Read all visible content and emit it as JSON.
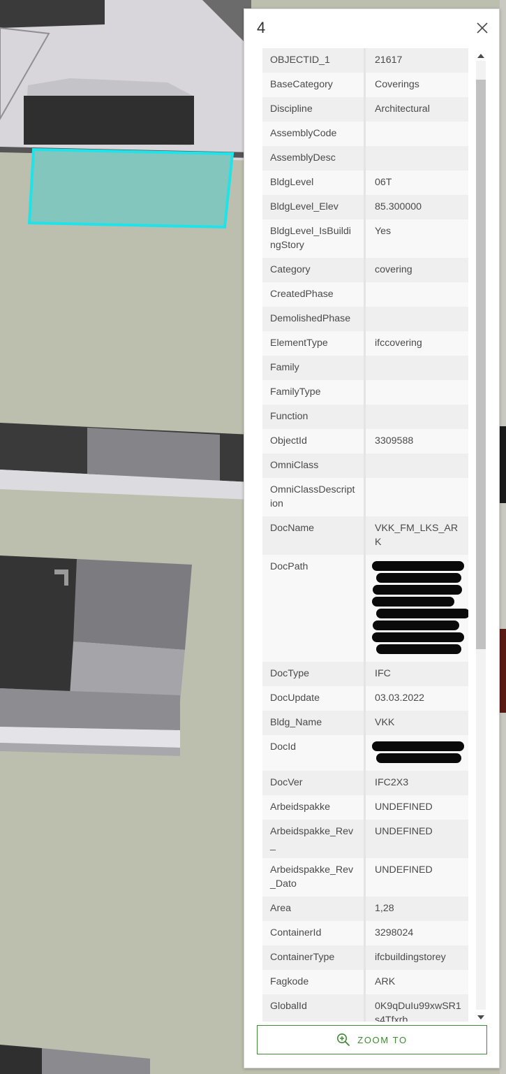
{
  "popup": {
    "title": "4",
    "close_icon": "close-icon",
    "zoom_label": "ZOOM TO",
    "zoom_icon": "zoom-in-icon",
    "scroll_position": 0.05,
    "scroll_visible_fraction": 0.6
  },
  "colors": {
    "accent": "#3f8a34",
    "selection": "#1fe3e8",
    "selection_fill": "#82c6be"
  },
  "attributes": [
    {
      "key": "OBJECTID_1",
      "value": "21617"
    },
    {
      "key": "BaseCategory",
      "value": "Coverings"
    },
    {
      "key": "Discipline",
      "value": "Architectural"
    },
    {
      "key": "AssemblyCode",
      "value": ""
    },
    {
      "key": "AssemblyDesc",
      "value": ""
    },
    {
      "key": "BldgLevel",
      "value": "06T"
    },
    {
      "key": "BldgLevel_Elev",
      "value": "85.300000"
    },
    {
      "key": "BldgLevel_IsBuildingStory",
      "value": "Yes"
    },
    {
      "key": "Category",
      "value": "covering"
    },
    {
      "key": "CreatedPhase",
      "value": ""
    },
    {
      "key": "DemolishedPhase",
      "value": ""
    },
    {
      "key": "ElementType",
      "value": "ifccovering"
    },
    {
      "key": "Family",
      "value": ""
    },
    {
      "key": "FamilyType",
      "value": ""
    },
    {
      "key": "Function",
      "value": ""
    },
    {
      "key": "ObjectId",
      "value": "3309588"
    },
    {
      "key": "OmniClass",
      "value": ""
    },
    {
      "key": "OmniClassDescription",
      "value": ""
    },
    {
      "key": "DocName",
      "value": "VKK_FM_LKS_ARK"
    },
    {
      "key": "DocPath",
      "value": "",
      "redacted_lines": 8
    },
    {
      "key": "DocType",
      "value": "IFC"
    },
    {
      "key": "DocUpdate",
      "value": "03.03.2022"
    },
    {
      "key": "Bldg_Name",
      "value": "VKK"
    },
    {
      "key": "DocId",
      "value": "",
      "redacted_lines": 2
    },
    {
      "key": "DocVer",
      "value": "IFC2X3"
    },
    {
      "key": "Arbeidspakke",
      "value": "UNDEFINED"
    },
    {
      "key": "Arbeidspakke_Rev_",
      "value": "UNDEFINED"
    },
    {
      "key": "Arbeidspakke_Rev_Dato",
      "value": "UNDEFINED"
    },
    {
      "key": "Area",
      "value": "1,28"
    },
    {
      "key": "ContainerId",
      "value": "3298024"
    },
    {
      "key": "ContainerType",
      "value": "ifcbuildingstorey"
    },
    {
      "key": "Fagkode",
      "value": "ARK"
    },
    {
      "key": "GlobalId",
      "value": "0K9qDuIu99xwSR1s4Tfxrb"
    }
  ]
}
